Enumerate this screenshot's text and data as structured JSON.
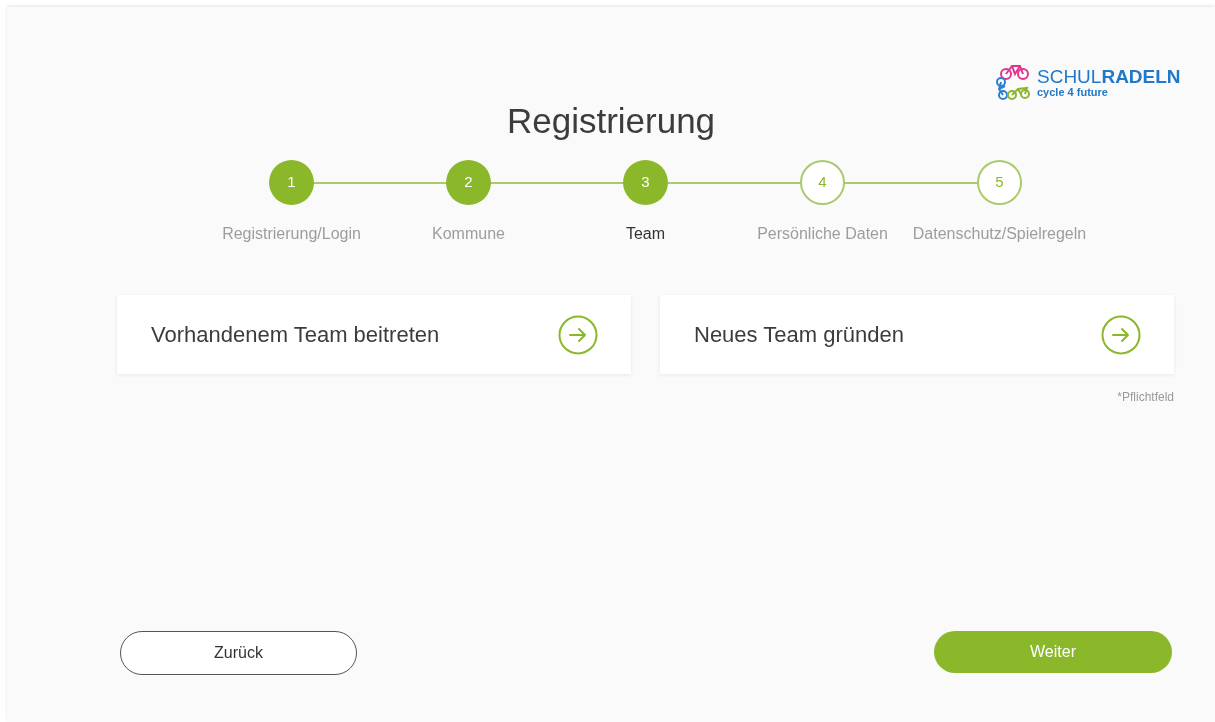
{
  "logo": {
    "brand": "SCHUL**RADELN**",
    "tagline": "cycle 4 future"
  },
  "title": "Registrierung",
  "steps": [
    {
      "number": "1",
      "label": "Registrierung/Login",
      "completed": true,
      "selected": false
    },
    {
      "number": "2",
      "label": "Kommune",
      "completed": true,
      "selected": false
    },
    {
      "number": "3",
      "label": "Team",
      "completed": true,
      "selected": true
    },
    {
      "number": "4",
      "label": "Persönliche Daten",
      "completed": false,
      "selected": false
    },
    {
      "number": "5",
      "label": "Datenschutz/Spielregeln",
      "completed": false,
      "selected": false
    }
  ],
  "options": [
    {
      "label": "Vorhandenem Team beitreten"
    },
    {
      "label": "Neues Team gründen"
    }
  ],
  "required_note": "*Pflichtfeld",
  "buttons": {
    "back": "Zurück",
    "next": "Weiter"
  }
}
